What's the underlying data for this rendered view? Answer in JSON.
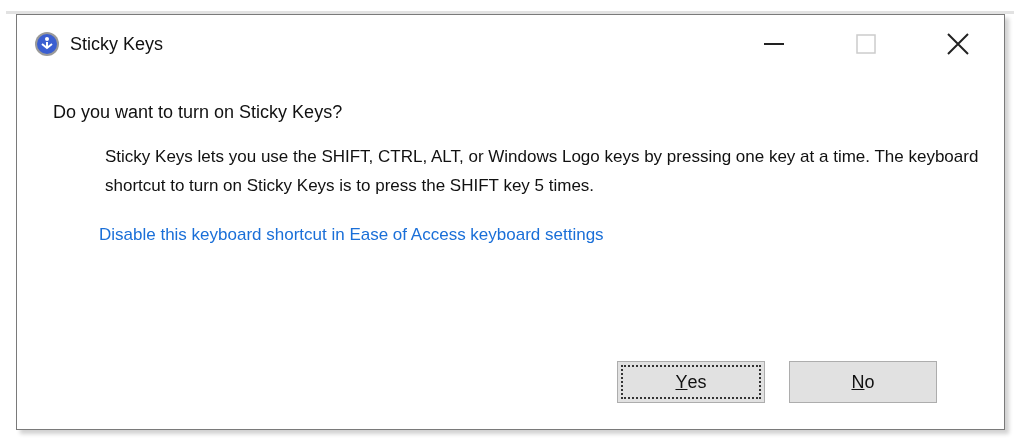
{
  "window": {
    "title": "Sticky Keys",
    "controls": [
      {
        "kind": "minimize",
        "disabled": false
      },
      {
        "kind": "maximize",
        "disabled": true
      },
      {
        "kind": "close",
        "disabled": false
      }
    ]
  },
  "question": "Do you want to turn on Sticky Keys?",
  "description": "Sticky Keys lets you use the SHIFT, CTRL, ALT, or Windows Logo keys by pressing one key at a time. The keyboard shortcut to turn on Sticky Keys is to press the SHIFT key 5 times.",
  "link": "Disable this keyboard shortcut in Ease of Access keyboard settings",
  "buttons": [
    {
      "label": "Yes",
      "focused": true
    },
    {
      "label": "No",
      "focused": false
    }
  ]
}
